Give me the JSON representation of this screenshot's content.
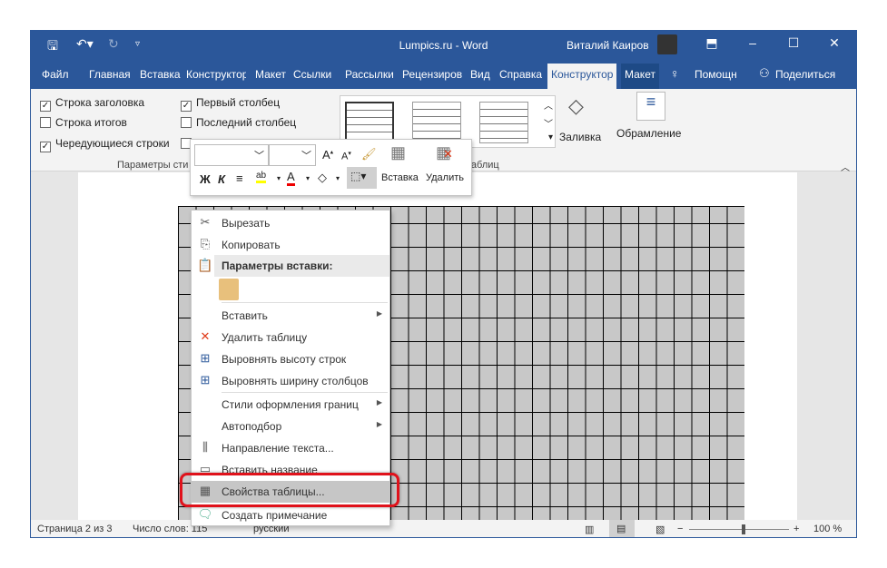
{
  "window": {
    "title": "Lumpics.ru  -  Word",
    "user": "Виталий Каиров"
  },
  "tabs": [
    "Файл",
    "Главная",
    "Вставка",
    "Конструктор",
    "Макет",
    "Ссылки",
    "Рассылки",
    "Рецензиров",
    "Вид",
    "Справка",
    "Конструктор",
    "Макет",
    "Помощн",
    "Поделиться"
  ],
  "ribbon": {
    "checkboxes": [
      {
        "label": "Строка заголовка",
        "checked": true
      },
      {
        "label": "Строка итогов",
        "checked": false
      },
      {
        "label": "Чередующиеся строки",
        "checked": true
      },
      {
        "label": "Первый столбец",
        "checked": true
      },
      {
        "label": "Последний столбец",
        "checked": false
      }
    ],
    "group1": "Параметры сти",
    "group2": "таблиц",
    "fill": "Заливка",
    "borders": "Обрамление"
  },
  "mini_toolbar": {
    "bold": "Ж",
    "italic": "К",
    "insert": "Вставка",
    "delete": "Удалить"
  },
  "context_menu": {
    "items": [
      {
        "label": "Вырезать",
        "icon": "scissors-icon"
      },
      {
        "label": "Копировать",
        "icon": "copy-icon"
      },
      {
        "label": "Параметры вставки:",
        "icon": "paste-icon",
        "header": true
      },
      {
        "label": "Вставить",
        "submenu": true
      },
      {
        "label": "Удалить таблицу",
        "icon": "delete-table-icon"
      },
      {
        "label": "Выровнять высоту строк",
        "icon": "distribute-rows-icon"
      },
      {
        "label": "Выровнять ширину столбцов",
        "icon": "distribute-columns-icon"
      },
      {
        "label": "Стили оформления границ",
        "submenu": true
      },
      {
        "label": "Автоподбор",
        "submenu": true
      },
      {
        "label": "Направление текста...",
        "icon": "text-direction-icon"
      },
      {
        "label": "Вставить название",
        "icon": "caption-icon"
      },
      {
        "label": "Свойства таблицы...",
        "icon": "table-properties-icon",
        "highlighted": true
      },
      {
        "label": "Создать примечание",
        "icon": "comment-icon"
      }
    ]
  },
  "status": {
    "page": "Страница 2 из 3",
    "words": "Число слов: 115",
    "lang": "русский",
    "zoom": "100 %"
  },
  "colors": {
    "accent": "#2b579a",
    "highlight": "#e0121b"
  }
}
